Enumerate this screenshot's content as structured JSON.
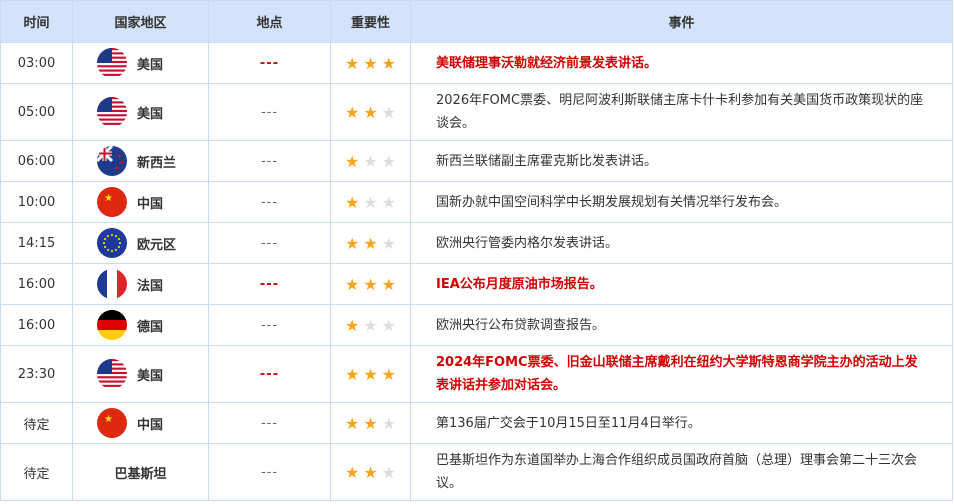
{
  "headers": [
    "时间",
    "国家地区",
    "地点",
    "重要性",
    "事件"
  ],
  "rows": [
    {
      "time": "03:00",
      "flag": "us",
      "country": "美国",
      "location": "---",
      "stars": 3,
      "event": "美联储理事沃勒就经济前景发表讲话。",
      "highlight": true
    },
    {
      "time": "05:00",
      "flag": "us",
      "country": "美国",
      "location": "---",
      "stars": 2,
      "event": "2026年FOMC票委、明尼阿波利斯联储主席卡什卡利参加有关美国货币政策现状的座谈会。",
      "highlight": false
    },
    {
      "time": "06:00",
      "flag": "nz",
      "country": "新西兰",
      "location": "---",
      "stars": 1,
      "event": "新西兰联储副主席霍克斯比发表讲话。",
      "highlight": false
    },
    {
      "time": "10:00",
      "flag": "cn",
      "country": "中国",
      "location": "---",
      "stars": 1,
      "event": "国新办就中国空间科学中长期发展规划有关情况举行发布会。",
      "highlight": false
    },
    {
      "time": "14:15",
      "flag": "eu",
      "country": "欧元区",
      "location": "---",
      "stars": 2,
      "event": "欧洲央行管委内格尔发表讲话。",
      "highlight": false
    },
    {
      "time": "16:00",
      "flag": "fr",
      "country": "法国",
      "location": "---",
      "stars": 3,
      "event": "IEA公布月度原油市场报告。",
      "highlight": true
    },
    {
      "time": "16:00",
      "flag": "de",
      "country": "德国",
      "location": "---",
      "stars": 1,
      "event": "欧洲央行公布贷款调查报告。",
      "highlight": false
    },
    {
      "time": "23:30",
      "flag": "us",
      "country": "美国",
      "location": "---",
      "stars": 3,
      "event": "2024年FOMC票委、旧金山联储主席戴利在纽约大学斯特恩商学院主办的活动上发表讲话并参加对话会。",
      "highlight": true
    },
    {
      "time": "待定",
      "flag": "cn",
      "country": "中国",
      "location": "---",
      "stars": 2,
      "event": "第136届广交会于10月15日至11月4日举行。",
      "highlight": false
    },
    {
      "time": "待定",
      "flag": "",
      "country": "巴基斯坦",
      "location": "---",
      "stars": 2,
      "event": "巴基斯坦作为东道国举办上海合作组织成员国政府首脑（总理）理事会第二十三次会议。",
      "highlight": false
    }
  ],
  "colors": {
    "header_bg": "#d2e3fb",
    "highlight": "#d00000",
    "star_on": "#f7a51c",
    "star_off": "#dddddd"
  }
}
